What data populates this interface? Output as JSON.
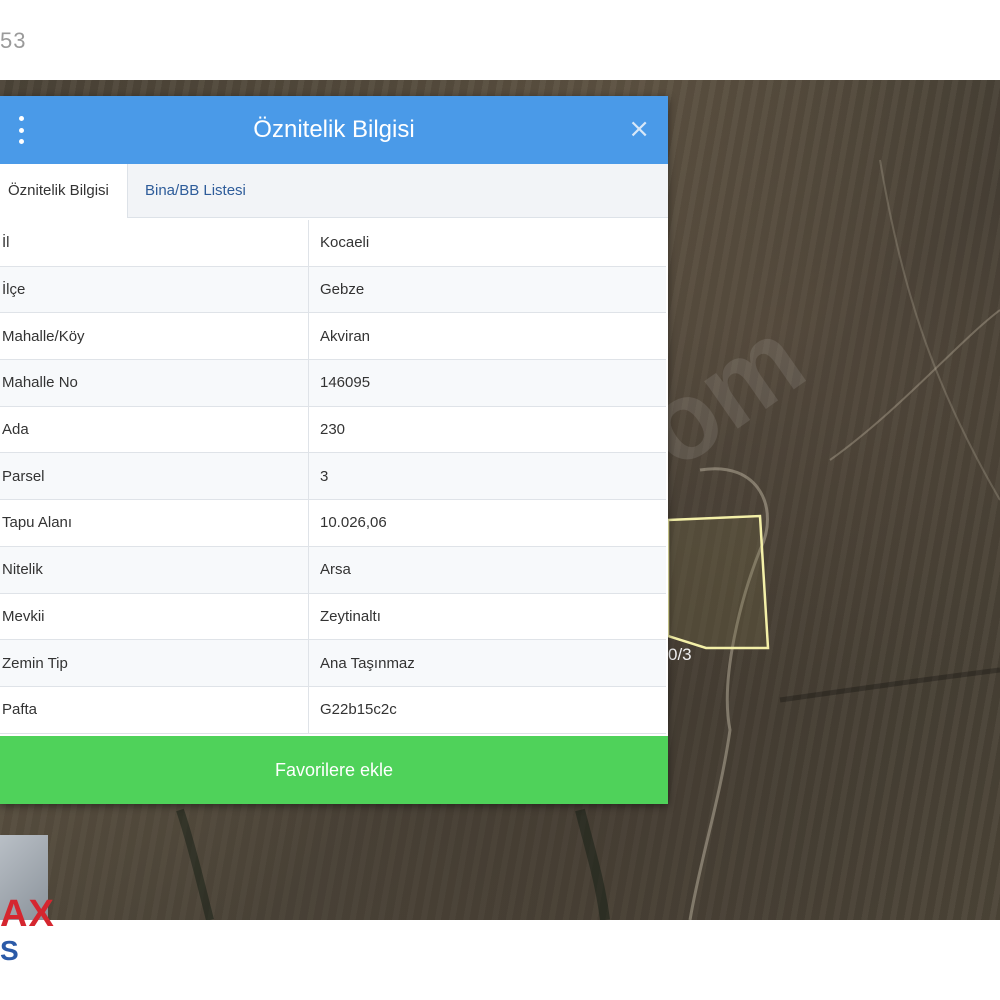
{
  "page": {
    "top_number": "53"
  },
  "map": {
    "parcel_label": "0/3"
  },
  "dialog": {
    "title": "Öznitelik Bilgisi",
    "close_glyph": "×",
    "tabs": [
      {
        "label": "Öznitelik Bilgisi",
        "active": true
      },
      {
        "label": "Bina/BB Listesi",
        "active": false
      }
    ],
    "rows": [
      {
        "key": "İl",
        "value": "Kocaeli"
      },
      {
        "key": "İlçe",
        "value": "Gebze"
      },
      {
        "key": "Mahalle/Köy",
        "value": "Akviran"
      },
      {
        "key": "Mahalle No",
        "value": "146095"
      },
      {
        "key": "Ada",
        "value": "230"
      },
      {
        "key": "Parsel",
        "value": "3"
      },
      {
        "key": "Tapu Alanı",
        "value": "10.026,06"
      },
      {
        "key": "Nitelik",
        "value": "Arsa"
      },
      {
        "key": "Mevkii",
        "value": "Zeytinaltı"
      },
      {
        "key": "Zemin Tip",
        "value": "Ana Taşınmaz"
      },
      {
        "key": "Pafta",
        "value": "G22b15c2c"
      }
    ],
    "favorite_button": "Favorilere ekle"
  },
  "logo": {
    "text": "AX",
    "sub": "S"
  },
  "colors": {
    "header_blue": "#4a9ae8",
    "button_green": "#4fd25a",
    "parcel_outline": "#f4f0a8",
    "logo_red": "#d5262f",
    "logo_blue": "#2b5aa8"
  },
  "icons": {
    "menu": "vertical-dots-icon",
    "close": "close-icon"
  }
}
